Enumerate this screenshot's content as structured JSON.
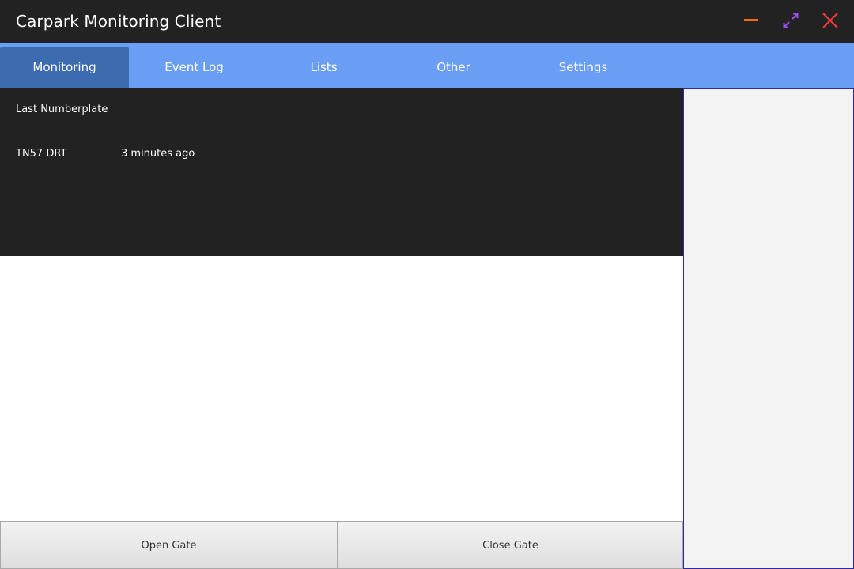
{
  "window": {
    "title": "Carpark Monitoring Client",
    "controls": {
      "minimize_color": "#ff6a00",
      "maximize_color": "#a04cf0",
      "close_color": "#ff3a3a"
    }
  },
  "tabs": [
    {
      "label": "Monitoring",
      "active": true
    },
    {
      "label": "Event Log",
      "active": false
    },
    {
      "label": "Lists",
      "active": false
    },
    {
      "label": "Other",
      "active": false
    },
    {
      "label": "Settings",
      "active": false
    }
  ],
  "monitoring": {
    "heading": "Last Numberplate",
    "plate": "TN57 DRT",
    "time_ago": "3 minutes ago"
  },
  "actions": {
    "open_gate": "Open Gate",
    "close_gate": "Close Gate"
  },
  "colors": {
    "titlebar_bg": "#222222",
    "tabbar_bg": "#6a9ef5",
    "active_tab_bg": "#3c6bb0",
    "side_panel_border": "#2a2aa8"
  }
}
